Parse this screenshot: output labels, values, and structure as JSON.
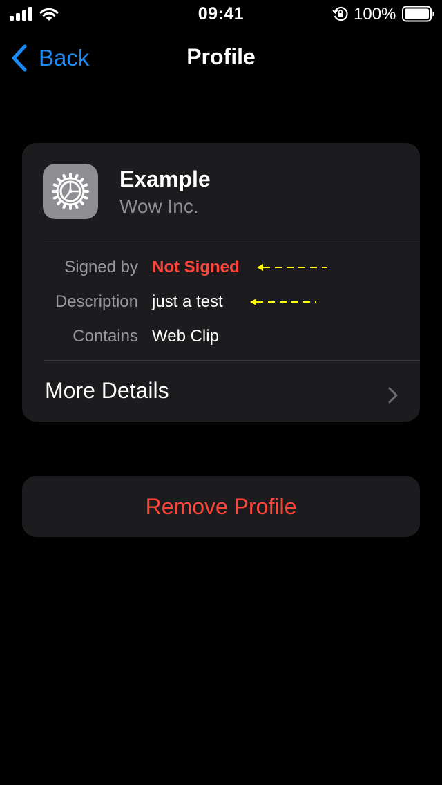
{
  "status_bar": {
    "time": "09:41",
    "battery_percent": "100%",
    "icons": [
      "signal-icon",
      "wifi-icon",
      "rotation-lock-icon",
      "battery-icon"
    ]
  },
  "nav": {
    "back_label": "Back",
    "title": "Profile"
  },
  "profile": {
    "name": "Example",
    "organization": "Wow Inc.",
    "icon": "settings-gear-icon",
    "details": [
      {
        "label": "Signed by",
        "value": "Not Signed"
      },
      {
        "label": "Description",
        "value": "just a test"
      },
      {
        "label": "Contains",
        "value": "Web Clip"
      }
    ],
    "more_details_label": "More Details"
  },
  "actions": {
    "remove_label": "Remove Profile"
  },
  "colors": {
    "accent_blue": "#1c8bfa",
    "destructive_red": "#ff453a",
    "annotation_yellow": "#ffff00",
    "card_background": "#1c1c1e",
    "secondary_text": "#98989d"
  }
}
